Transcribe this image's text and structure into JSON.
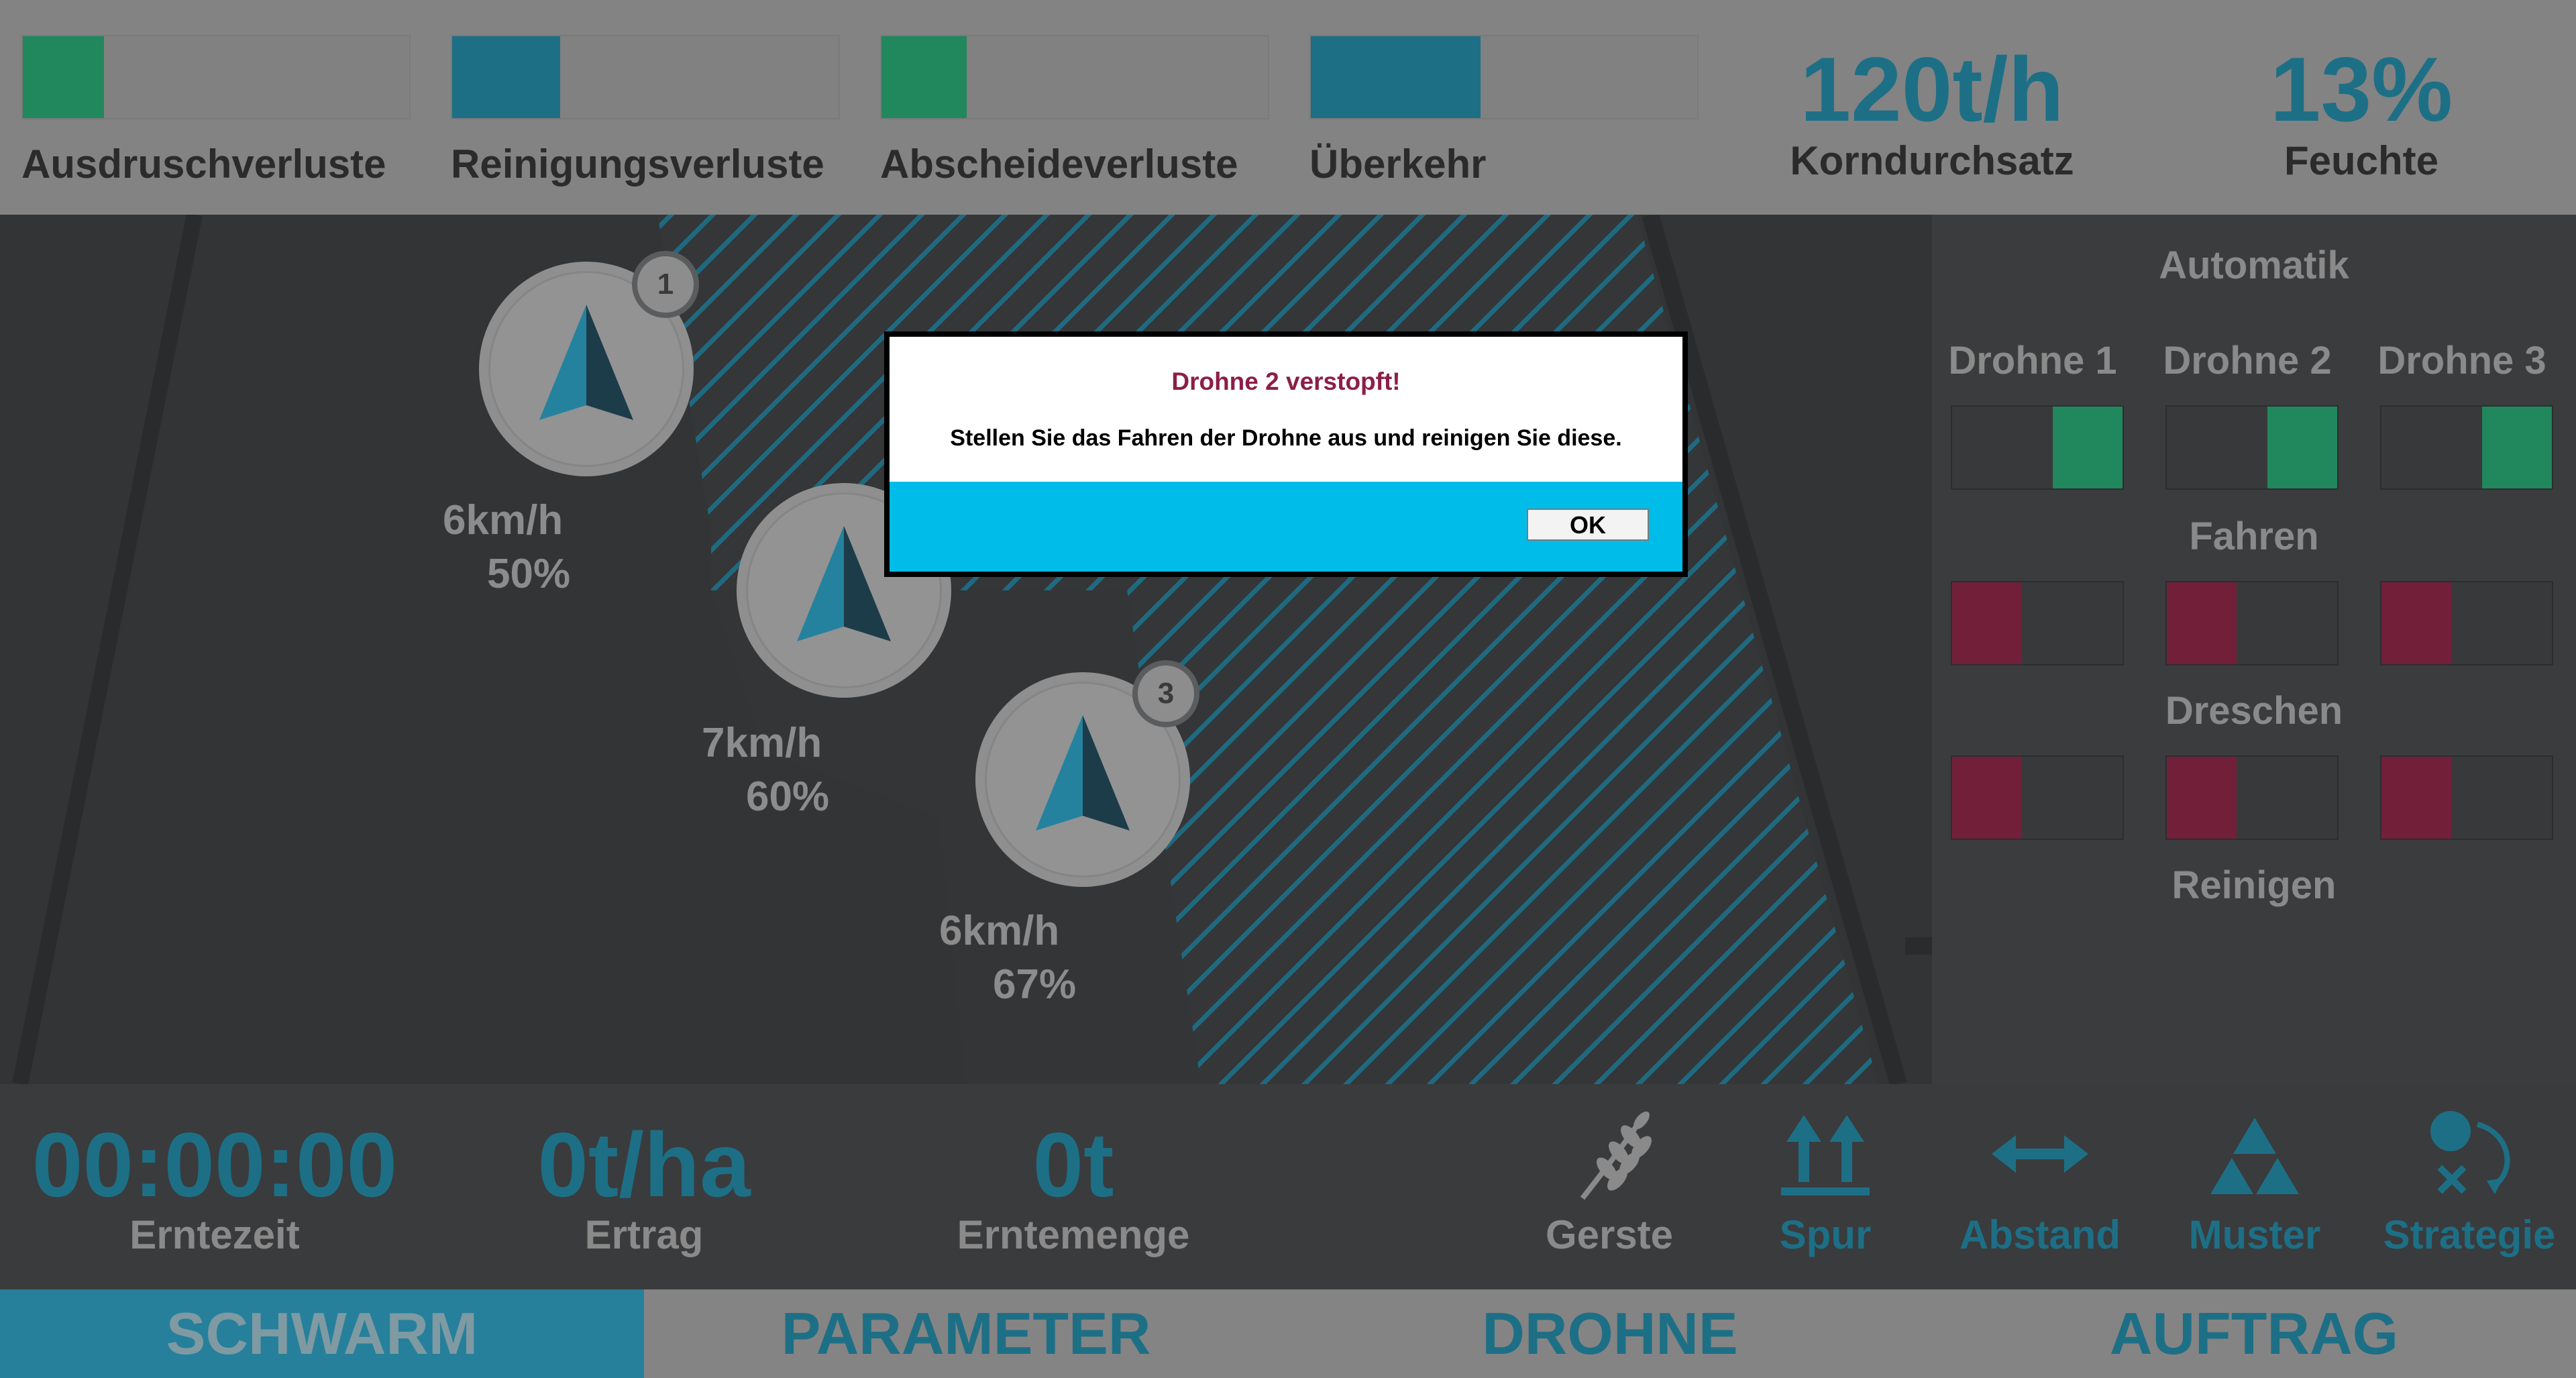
{
  "top_bar": {
    "gauges": [
      {
        "label": "Ausdruschverluste",
        "level": 0.21,
        "color": "#21875d"
      },
      {
        "label": "Reinigungsverluste",
        "level": 0.28,
        "color": "#1d6f86"
      },
      {
        "label": "Abscheideverluste",
        "level": 0.22,
        "color": "#21875d"
      },
      {
        "label": "Überkehr",
        "level": 0.44,
        "color": "#1d6f86"
      }
    ],
    "throughput": {
      "value": "120t/h",
      "label": "Korndurchsatz"
    },
    "moisture": {
      "value": "13%",
      "label": "Feuchte"
    }
  },
  "field": {
    "drones": [
      {
        "number": "1",
        "speed": "6km/h",
        "percent": "50%"
      },
      {
        "number": "",
        "speed": "7km/h",
        "percent": "60%"
      },
      {
        "number": "3",
        "speed": "6km/h",
        "percent": "67%"
      }
    ]
  },
  "right_panel": {
    "automatik_label": "Automatik",
    "drone_labels": [
      "Drohne 1",
      "Drohne 2",
      "Drohne 3"
    ],
    "fahren_label": "Fahren",
    "dreschen_label": "Dreschen",
    "reinigen_label": "Reinigen",
    "automatik_states": [
      "on",
      "on",
      "on"
    ],
    "fahren_states": [
      "off",
      "off",
      "off"
    ],
    "dreschen_states": [
      "off",
      "off",
      "off"
    ]
  },
  "info_bar": {
    "harvest_time": {
      "value": "00:00:00",
      "label": "Erntezeit"
    },
    "yield": {
      "value": "0t/ha",
      "label": "Ertrag"
    },
    "harvest_amount": {
      "value": "0t",
      "label": "Erntemenge"
    },
    "tools": [
      {
        "label": "Gerste",
        "icon": "wheat-icon"
      },
      {
        "label": "Spur",
        "icon": "lanes-up-icon"
      },
      {
        "label": "Abstand",
        "icon": "distance-arrow-icon"
      },
      {
        "label": "Muster",
        "icon": "triforce-pattern-icon"
      },
      {
        "label": "Strategie",
        "icon": "strategy-play-icon"
      }
    ]
  },
  "nav": {
    "tabs": [
      "SCHWARM",
      "PARAMETER",
      "DROHNE",
      "AUFTRAG"
    ],
    "active": "SCHWARM"
  },
  "dialog": {
    "title": "Drohne 2 verstopft!",
    "message": "Stellen Sie das Fahren der Drohne aus und reinigen Sie diese.",
    "ok_label": "OK"
  },
  "colors": {
    "accent_blue": "#1d6f86",
    "green": "#21875d",
    "red": "#72203a",
    "dialog_bar": "#00bce8",
    "dialog_title": "#8c1e47"
  }
}
